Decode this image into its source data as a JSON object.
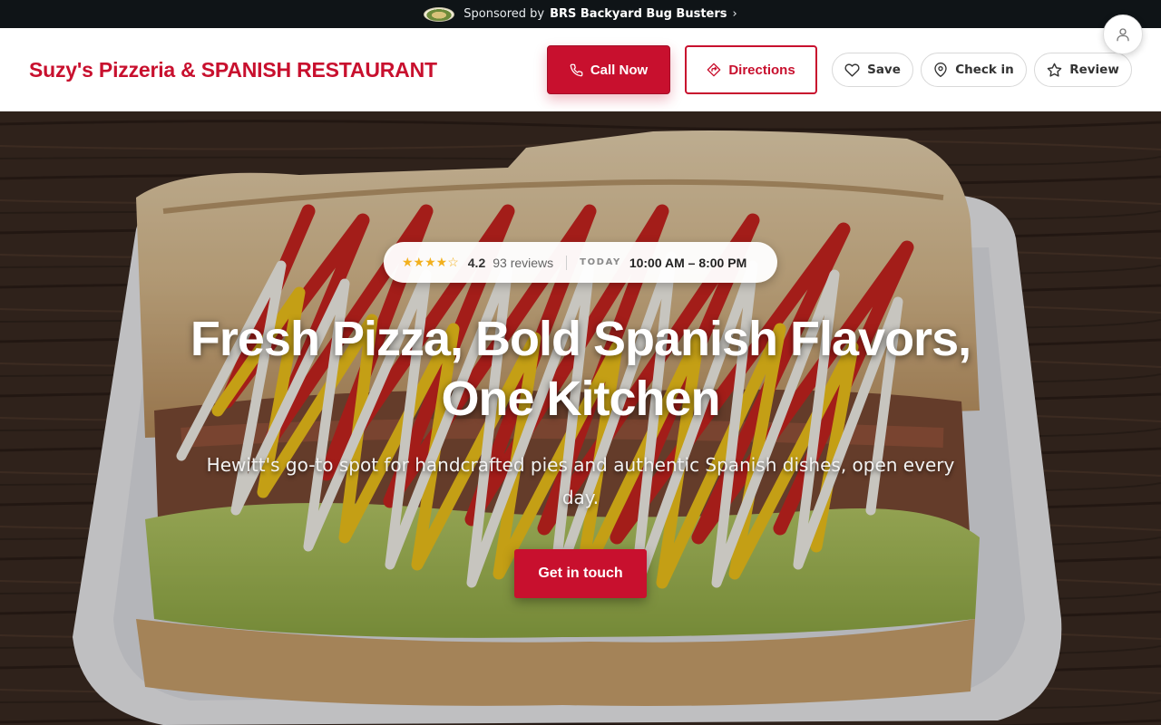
{
  "sponsor": {
    "prefix": "Sponsored by",
    "name": "BRS Backyard Bug Busters",
    "chevron": "›",
    "logo_icon": "sponsor-logo"
  },
  "header": {
    "brand": "Suzy's Pizzeria & SPANISH RESTAURANT",
    "call_label": "Call Now",
    "directions_label": "Directions",
    "save_label": "Save",
    "checkin_label": "Check in",
    "review_label": "Review",
    "account_icon": "user-icon"
  },
  "hero": {
    "stars": "★★★★☆",
    "rating": "4.2",
    "reviews": "93 reviews",
    "today_label": "TODAY",
    "hours": "10:00 AM – 8:00 PM",
    "headline_line1": "Fresh Pizza, Bold Spanish Flavors,",
    "headline_line2": "One Kitchen",
    "subtitle": "Hewitt's go-to spot for handcrafted pies and authentic Spanish dishes, open every day.",
    "cta_label": "Get in touch",
    "image_subject": "sandwich-with-ketchup-mustard-mayo-on-foam-tray"
  },
  "colors": {
    "brand_red": "#c8102e",
    "sponsor_bar": "#0f1417",
    "star_gold": "#f2b01e"
  }
}
